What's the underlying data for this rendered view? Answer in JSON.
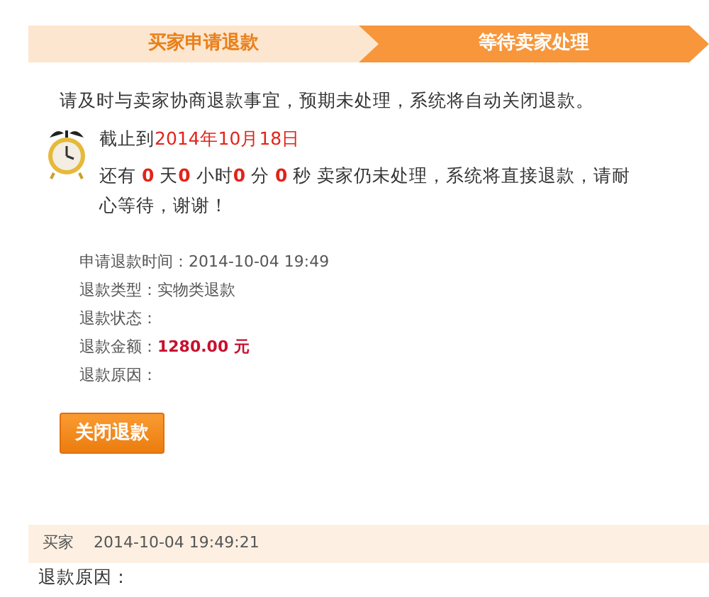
{
  "steps": [
    {
      "label": "买家申请退款",
      "selected": false
    },
    {
      "label": "等待卖家处理",
      "selected": true
    }
  ],
  "notice": "请及时与卖家协商退款事宜，预期未处理，系统将自动关闭退款。",
  "deadline": [
    {
      "text": "截止到",
      "highlight": false
    },
    {
      "text": "2014年10月18日",
      "highlight": true
    }
  ],
  "countdown": [
    {
      "text": "还有 ",
      "highlight": false
    },
    {
      "text": "0",
      "highlight": true
    },
    {
      "text": " 天",
      "highlight": false
    },
    {
      "text": "0",
      "highlight": true
    },
    {
      "text": " 小时",
      "highlight": false
    },
    {
      "text": "0",
      "highlight": true
    },
    {
      "text": " 分 ",
      "highlight": false
    },
    {
      "text": "0",
      "highlight": true
    },
    {
      "text": " 秒 卖家仍未处理，系统将直接退款，请耐心等待，谢谢！",
      "highlight": false
    }
  ],
  "details": [
    {
      "label": "申请退款时间：",
      "value": "2014-10-04 19:49",
      "kind": "plain"
    },
    {
      "label": "退款类型：",
      "value": "实物类退款",
      "kind": "plain"
    },
    {
      "label": "退款状态：",
      "kind": "plain"
    },
    {
      "label": "退款金额：",
      "value": "1280.00 元",
      "kind": "amount"
    },
    {
      "label": "退款原因：",
      "kind": "plain"
    }
  ],
  "close_button": "关闭退款",
  "log": {
    "author": "买家",
    "time": "2014-10-04 19:49:21",
    "reason_label": "退款原因："
  }
}
